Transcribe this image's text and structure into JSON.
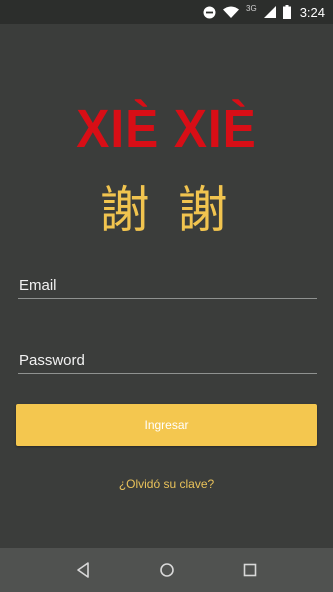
{
  "status_bar": {
    "time": "3:24",
    "network_label": "3G",
    "icons": [
      "do-not-disturb-icon",
      "wifi-icon",
      "signal-icon",
      "battery-icon"
    ]
  },
  "logo": {
    "title": "XIÈ XIÈ",
    "chinese": "謝 謝"
  },
  "form": {
    "email_placeholder": "Email",
    "password_placeholder": "Password",
    "submit_label": "Ingresar",
    "forgot_label": "¿Olvidó su clave?"
  },
  "colors": {
    "background": "#3b3d3b",
    "title_red": "#d80e16",
    "accent_yellow": "#f4c74f"
  },
  "nav_bar": {
    "icons": [
      "back-icon",
      "home-icon",
      "recents-icon"
    ]
  }
}
